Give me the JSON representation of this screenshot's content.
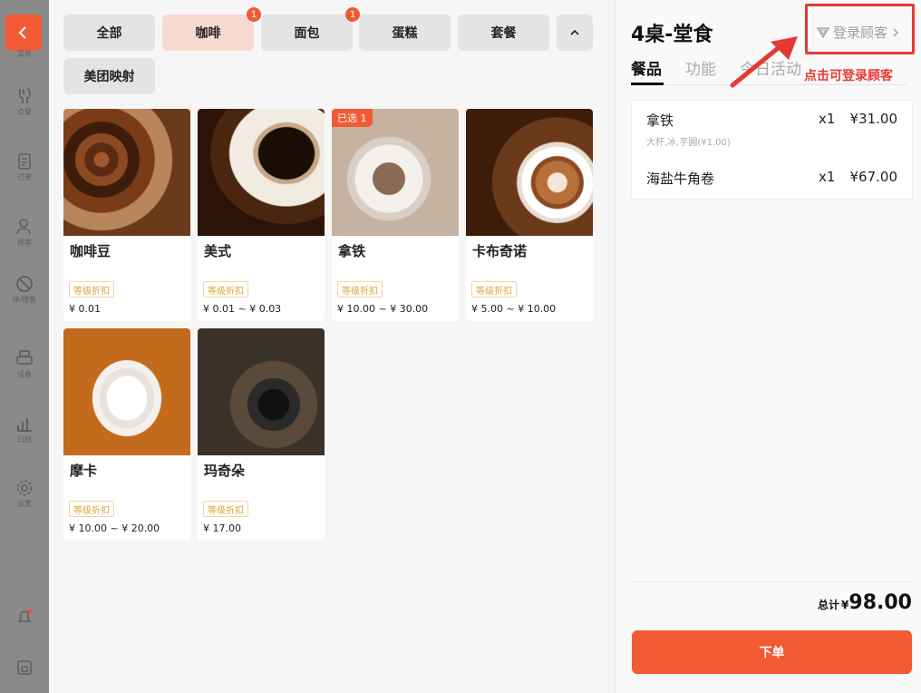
{
  "sidebar": {
    "items": [
      {
        "label": "菜单",
        "icon": "menu-icon"
      },
      {
        "label": "点餐",
        "icon": "order-dish-icon"
      },
      {
        "label": "订单",
        "icon": "document-icon"
      },
      {
        "label": "顾客",
        "icon": "customer-icon"
      },
      {
        "label": "停/限售",
        "icon": "ban-icon"
      },
      {
        "label": "设备",
        "icon": "printer-icon"
      },
      {
        "label": "日结",
        "icon": "chart-icon"
      },
      {
        "label": "设置",
        "icon": "gear-icon"
      }
    ]
  },
  "categories": [
    {
      "label": "全部",
      "badge": ""
    },
    {
      "label": "咖啡",
      "badge": "1"
    },
    {
      "label": "面包",
      "badge": "1"
    },
    {
      "label": "蛋糕",
      "badge": ""
    },
    {
      "label": "套餐",
      "badge": ""
    },
    {
      "label": "美团映射",
      "badge": ""
    }
  ],
  "products": [
    {
      "name": "咖啡豆",
      "tag": "等级折扣",
      "price": "¥ 0.01",
      "selected": ""
    },
    {
      "name": "美式",
      "tag": "等级折扣",
      "price": "¥ 0.01 ~ ¥ 0.03",
      "selected": ""
    },
    {
      "name": "拿铁",
      "tag": "等级折扣",
      "price": "¥ 10.00 ~ ¥ 30.00",
      "selected": "已选 1"
    },
    {
      "name": "卡布奇诺",
      "tag": "等级折扣",
      "price": "¥ 5.00 ~ ¥ 10.00",
      "selected": ""
    },
    {
      "name": "摩卡",
      "tag": "等级折扣",
      "price": "¥ 10.00 ~ ¥ 20.00",
      "selected": ""
    },
    {
      "name": "玛奇朵",
      "tag": "等级折扣",
      "price": "¥ 17.00",
      "selected": ""
    }
  ],
  "cart": {
    "title": "4桌-堂食",
    "login_label": "登录顾客",
    "hint": "点击可登录顾客",
    "tabs": [
      "餐品",
      "功能",
      "今日活动"
    ],
    "items": [
      {
        "name": "拿铁",
        "sub": "大杯,冰,芋圆(¥1.00)",
        "qty": "x1",
        "price": "¥31.00"
      },
      {
        "name": "海盐牛角卷",
        "sub": "",
        "qty": "x1",
        "price": "¥67.00"
      }
    ],
    "total_label": "总计",
    "currency": "¥",
    "total_value": "98.00",
    "submit_label": "下单"
  },
  "colors": {
    "accent": "#f25a33",
    "highlight": "#e53935",
    "tag": "#d9a63a"
  }
}
